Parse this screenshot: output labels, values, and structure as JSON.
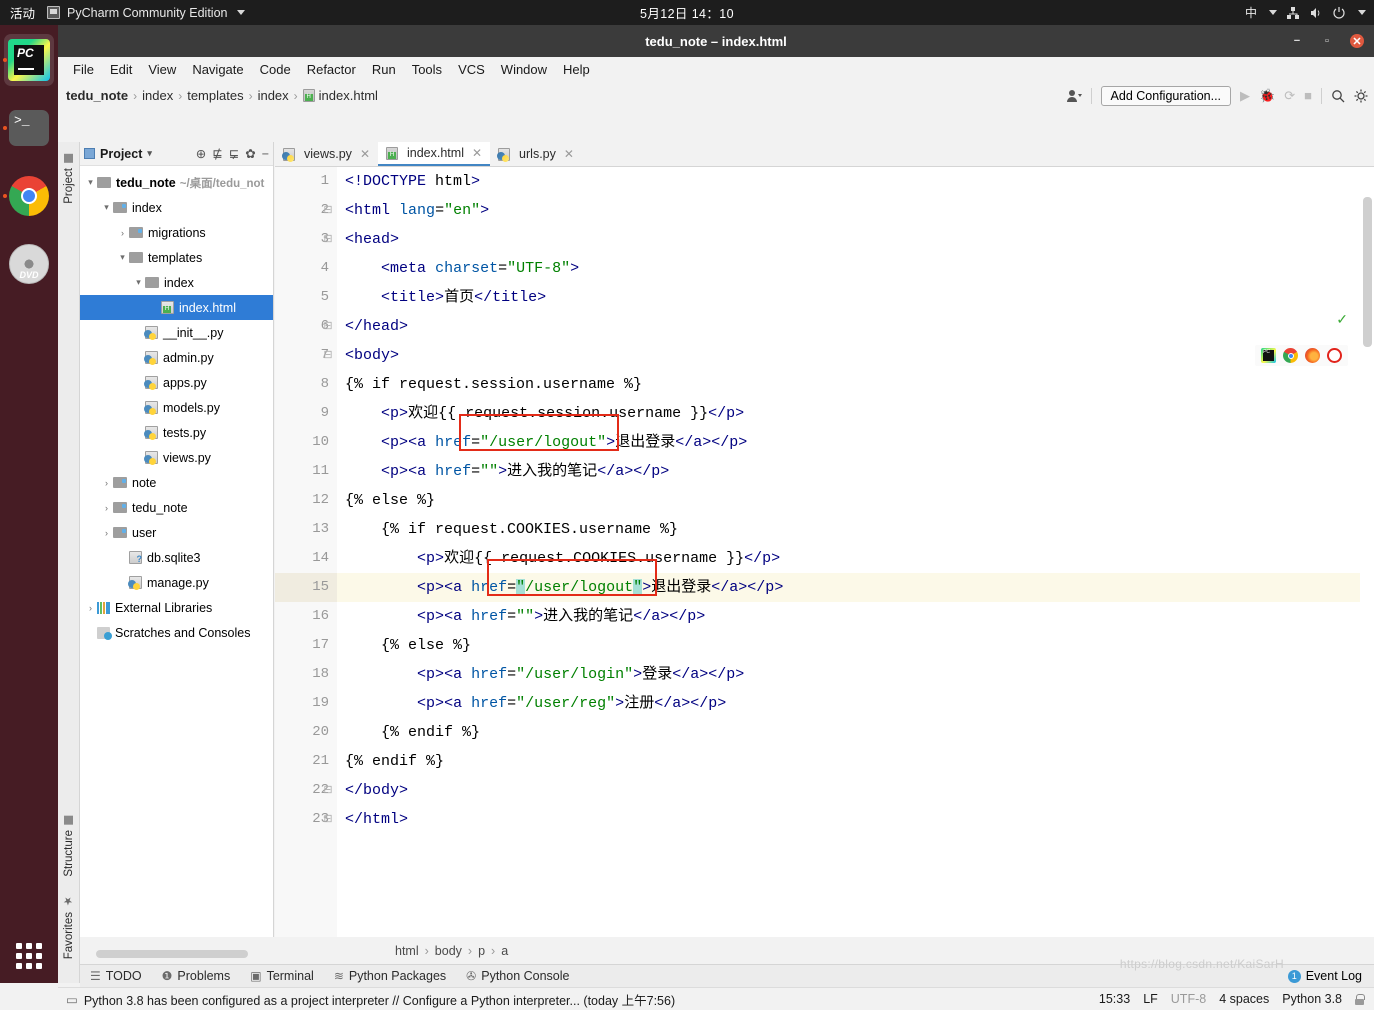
{
  "os_bar": {
    "activities": "活动",
    "app_name": "PyCharm Community Edition",
    "clock": "5月12日  14：10",
    "input_method": "中",
    "icons": [
      "network-icon",
      "volume-icon",
      "power-icon",
      "chevron-down-icon"
    ]
  },
  "dock": {
    "items": [
      {
        "name": "pycharm",
        "label": "PyCharm"
      },
      {
        "name": "terminal",
        "label": "Terminal"
      },
      {
        "name": "chrome",
        "label": "Google Chrome"
      },
      {
        "name": "dvd",
        "label": "DVD"
      }
    ],
    "show_apps": "Show Applications"
  },
  "window": {
    "title": "tedu_note – index.html",
    "buttons": [
      "minimize",
      "maximize",
      "close"
    ]
  },
  "menu": [
    "File",
    "Edit",
    "View",
    "Navigate",
    "Code",
    "Refactor",
    "Run",
    "Tools",
    "VCS",
    "Window",
    "Help"
  ],
  "navbar": {
    "crumbs": [
      "tedu_note",
      "index",
      "templates",
      "index",
      "index.html"
    ],
    "add_configuration": "Add Configuration...",
    "icons": [
      "user-icon",
      "run-icon",
      "debug-icon",
      "coverage-icon",
      "stop-icon",
      "search-icon",
      "gear-icon"
    ]
  },
  "tool_strip": {
    "project": "Project",
    "structure": "Structure",
    "favorites": "Favorites"
  },
  "project_panel": {
    "title": "Project",
    "toolbar_icons": [
      "target-icon",
      "collapse-icon",
      "expand-icon",
      "gear-icon",
      "minimize-icon"
    ],
    "tree": [
      {
        "label": "tedu_note",
        "note": "~/桌面/tedu_not",
        "indent": 0,
        "arrow": "▾",
        "icon": "folder-icon",
        "bold": true
      },
      {
        "label": "index",
        "indent": 1,
        "arrow": "▾",
        "icon": "folder-source-icon"
      },
      {
        "label": "migrations",
        "indent": 2,
        "arrow": "›",
        "icon": "folder-source-icon"
      },
      {
        "label": "templates",
        "indent": 2,
        "arrow": "▾",
        "icon": "folder-icon"
      },
      {
        "label": "index",
        "indent": 3,
        "arrow": "▾",
        "icon": "folder-icon"
      },
      {
        "label": "index.html",
        "indent": 4,
        "arrow": "",
        "icon": "html-file-icon",
        "selected": true
      },
      {
        "label": "__init__.py",
        "indent": 3,
        "arrow": "",
        "icon": "python-file-icon"
      },
      {
        "label": "admin.py",
        "indent": 3,
        "arrow": "",
        "icon": "python-file-icon"
      },
      {
        "label": "apps.py",
        "indent": 3,
        "arrow": "",
        "icon": "python-file-icon"
      },
      {
        "label": "models.py",
        "indent": 3,
        "arrow": "",
        "icon": "python-file-icon"
      },
      {
        "label": "tests.py",
        "indent": 3,
        "arrow": "",
        "icon": "python-file-icon"
      },
      {
        "label": "views.py",
        "indent": 3,
        "arrow": "",
        "icon": "python-file-icon"
      },
      {
        "label": "note",
        "indent": 1,
        "arrow": "›",
        "icon": "folder-source-icon"
      },
      {
        "label": "tedu_note",
        "indent": 1,
        "arrow": "›",
        "icon": "folder-source-icon"
      },
      {
        "label": "user",
        "indent": 1,
        "arrow": "›",
        "icon": "folder-source-icon"
      },
      {
        "label": "db.sqlite3",
        "indent": 2,
        "arrow": "",
        "icon": "db-file-icon"
      },
      {
        "label": "manage.py",
        "indent": 2,
        "arrow": "",
        "icon": "python-file-icon"
      },
      {
        "label": "External Libraries",
        "indent": 0,
        "arrow": "›",
        "icon": "library-icon"
      },
      {
        "label": "Scratches and Consoles",
        "indent": 0,
        "arrow": "",
        "icon": "scratches-icon"
      }
    ]
  },
  "editor": {
    "tabs": [
      {
        "label": "views.py",
        "icon": "python-file-icon",
        "active": false
      },
      {
        "label": "index.html",
        "icon": "html-file-icon",
        "active": true
      },
      {
        "label": "urls.py",
        "icon": "python-file-icon",
        "active": false
      }
    ],
    "browser_icons": [
      "pycharm-preview-icon",
      "chrome-icon",
      "firefox-icon",
      "opera-icon"
    ],
    "inspection_status": "✓",
    "lines": [
      {
        "n": 1,
        "text": "<!DOCTYPE html>"
      },
      {
        "n": 2,
        "text": "<html lang=\"en\">",
        "fold": true
      },
      {
        "n": 3,
        "text": "<head>",
        "fold": true
      },
      {
        "n": 4,
        "text": "    <meta charset=\"UTF-8\">"
      },
      {
        "n": 5,
        "text": "    <title>首页</title>"
      },
      {
        "n": 6,
        "text": "</head>",
        "fold": true
      },
      {
        "n": 7,
        "text": "<body>",
        "fold": true
      },
      {
        "n": 8,
        "text": "{% if request.session.username %}"
      },
      {
        "n": 9,
        "text": "    <p>欢迎{{ request.session.username }}</p>"
      },
      {
        "n": 10,
        "text": "    <p><a href=\"/user/logout\">退出登录</a></p>"
      },
      {
        "n": 11,
        "text": "    <p><a href=\"\">进入我的笔记</a></p>"
      },
      {
        "n": 12,
        "text": "{% else %}"
      },
      {
        "n": 13,
        "text": "    {% if request.COOKIES.username %}"
      },
      {
        "n": 14,
        "text": "        <p>欢迎{{ request.COOKIES.username }}</p>"
      },
      {
        "n": 15,
        "text": "        <p><a href=\"/user/logout\">退出登录</a></p>",
        "highlighted": true
      },
      {
        "n": 16,
        "text": "        <p><a href=\"\">进入我的笔记</a></p>"
      },
      {
        "n": 17,
        "text": "    {% else %}"
      },
      {
        "n": 18,
        "text": "        <p><a href=\"/user/login\">登录</a></p>"
      },
      {
        "n": 19,
        "text": "        <p><a href=\"/user/reg\">注册</a></p>"
      },
      {
        "n": 20,
        "text": "    {% endif %}"
      },
      {
        "n": 21,
        "text": "{% endif %}"
      },
      {
        "n": 22,
        "text": "</body>",
        "fold": true
      },
      {
        "n": 23,
        "text": "</html>",
        "fold": true
      }
    ],
    "annotations": [
      {
        "name": "red-highlight-box-line10",
        "target_line": 10
      },
      {
        "name": "red-highlight-box-line15",
        "target_line": 15
      }
    ],
    "breadcrumb": [
      "html",
      "body",
      "p",
      "a"
    ]
  },
  "tool_window_bar": {
    "items": [
      {
        "label": "TODO",
        "icon": "todo-icon"
      },
      {
        "label": "Problems",
        "icon": "problems-icon"
      },
      {
        "label": "Terminal",
        "icon": "terminal-icon"
      },
      {
        "label": "Python Packages",
        "icon": "packages-icon"
      },
      {
        "label": "Python Console",
        "icon": "console-icon"
      }
    ],
    "event_log": {
      "label": "Event Log",
      "count": "1"
    }
  },
  "status_bar": {
    "message": "Python 3.8 has been configured as a project interpreter // Configure a Python interpreter... (today 上午7:56)",
    "time": "15:33",
    "line_sep": "LF",
    "encoding": "UTF-8",
    "indent": "4 spaces",
    "interpreter": "Python 3.8",
    "lock": "lock-icon"
  },
  "watermark": "https://blog.csdn.net/KaiSarH"
}
